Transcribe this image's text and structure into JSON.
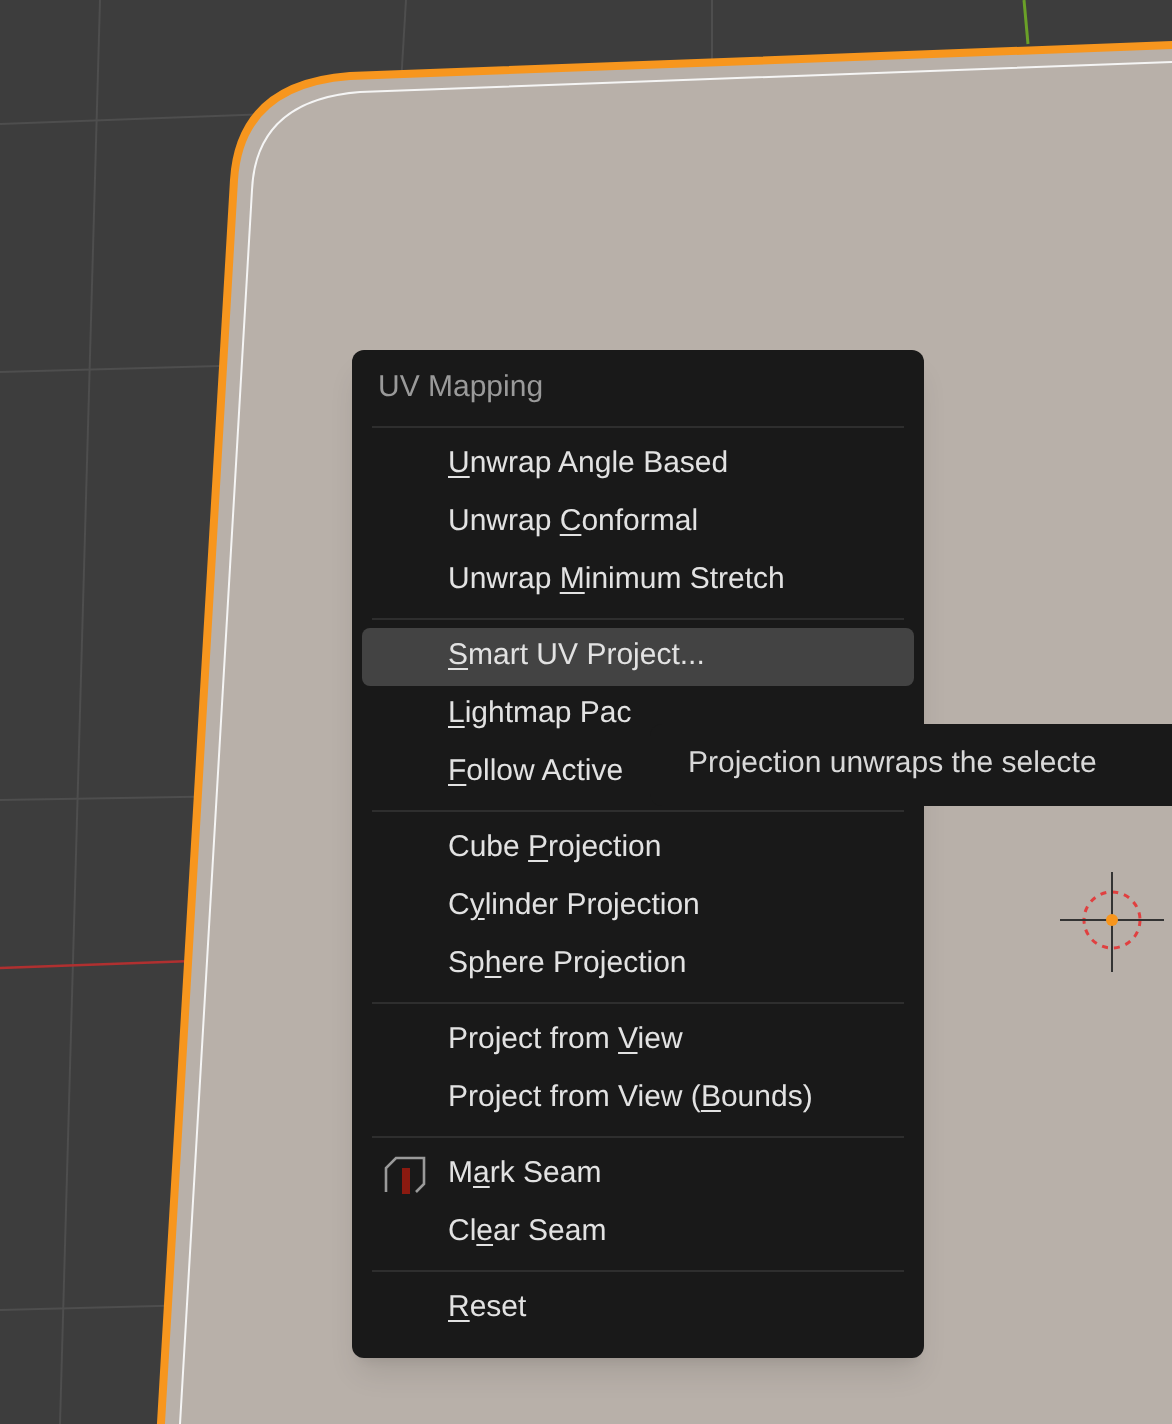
{
  "menu": {
    "title": "UV Mapping",
    "groups": [
      {
        "items": [
          {
            "label": {
              "key": "U",
              "after": "nwrap Angle Based"
            },
            "kind": "text",
            "selected": false
          },
          {
            "label": {
              "before": "Unwrap ",
              "key": "C",
              "after": "onformal"
            },
            "kind": "text",
            "selected": false
          },
          {
            "label": {
              "before": "Unwrap ",
              "key": "M",
              "after": "inimum Stretch"
            },
            "kind": "text",
            "selected": false
          }
        ]
      },
      {
        "items": [
          {
            "label": {
              "key": "S",
              "after": "mart UV Project..."
            },
            "kind": "text",
            "selected": true
          },
          {
            "label": {
              "key": "L",
              "after": "ightmap Pac"
            },
            "kind": "text",
            "selected": false
          },
          {
            "label": {
              "key": "F",
              "after": "ollow Active"
            },
            "kind": "text",
            "selected": false
          }
        ]
      },
      {
        "items": [
          {
            "label": {
              "before": "Cube ",
              "key": "P",
              "after": "rojection"
            },
            "kind": "text",
            "selected": false
          },
          {
            "label": {
              "before": "C",
              "key": "y",
              "after": "linder Projection"
            },
            "kind": "text",
            "selected": false
          },
          {
            "label": {
              "before": "Sp",
              "key": "h",
              "after": "ere Projection"
            },
            "kind": "text",
            "selected": false
          }
        ]
      },
      {
        "items": [
          {
            "label": {
              "before": "Project from ",
              "key": "V",
              "after": "iew"
            },
            "kind": "text",
            "selected": false
          },
          {
            "label": {
              "before": "Project from View (",
              "key": "B",
              "after": "ounds)"
            },
            "kind": "text",
            "selected": false
          }
        ]
      },
      {
        "items": [
          {
            "label": {
              "before": "M",
              "key": "a",
              "after": "rk Seam"
            },
            "kind": "icon",
            "selected": false
          },
          {
            "label": {
              "before": "Cl",
              "key": "e",
              "after": "ar Seam"
            },
            "kind": "text",
            "selected": false
          }
        ]
      },
      {
        "items": [
          {
            "label": {
              "key": "R",
              "after": "eset"
            },
            "kind": "text",
            "selected": false
          }
        ]
      }
    ]
  },
  "tooltip": {
    "text": "Projection unwraps the selecte"
  }
}
